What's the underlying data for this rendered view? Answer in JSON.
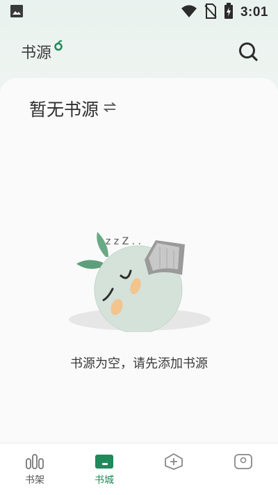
{
  "status_bar": {
    "time": "3:01",
    "icons": [
      "gallery-icon",
      "wifi-icon",
      "no-sim-icon",
      "battery-charging-icon"
    ]
  },
  "header": {
    "title": "书源",
    "search_icon": "search-icon"
  },
  "source_selector": {
    "label": "暂无书源",
    "switch_icon": "swap-arrows-icon"
  },
  "empty_state": {
    "message": "书源为空，请先添加书源",
    "snore": "z z Z . ."
  },
  "bottom_nav": {
    "items": [
      {
        "label": "书架",
        "icon": "bookshelf-icon",
        "active": false
      },
      {
        "label": "书城",
        "icon": "bookstore-icon",
        "active": true
      },
      {
        "label": "",
        "icon": "add-icon",
        "active": false
      },
      {
        "label": "",
        "icon": "profile-icon",
        "active": false
      }
    ]
  },
  "colors": {
    "accent": "#1f8a5a",
    "background": "#fafafa",
    "header_tint": "#e9f2ee"
  }
}
